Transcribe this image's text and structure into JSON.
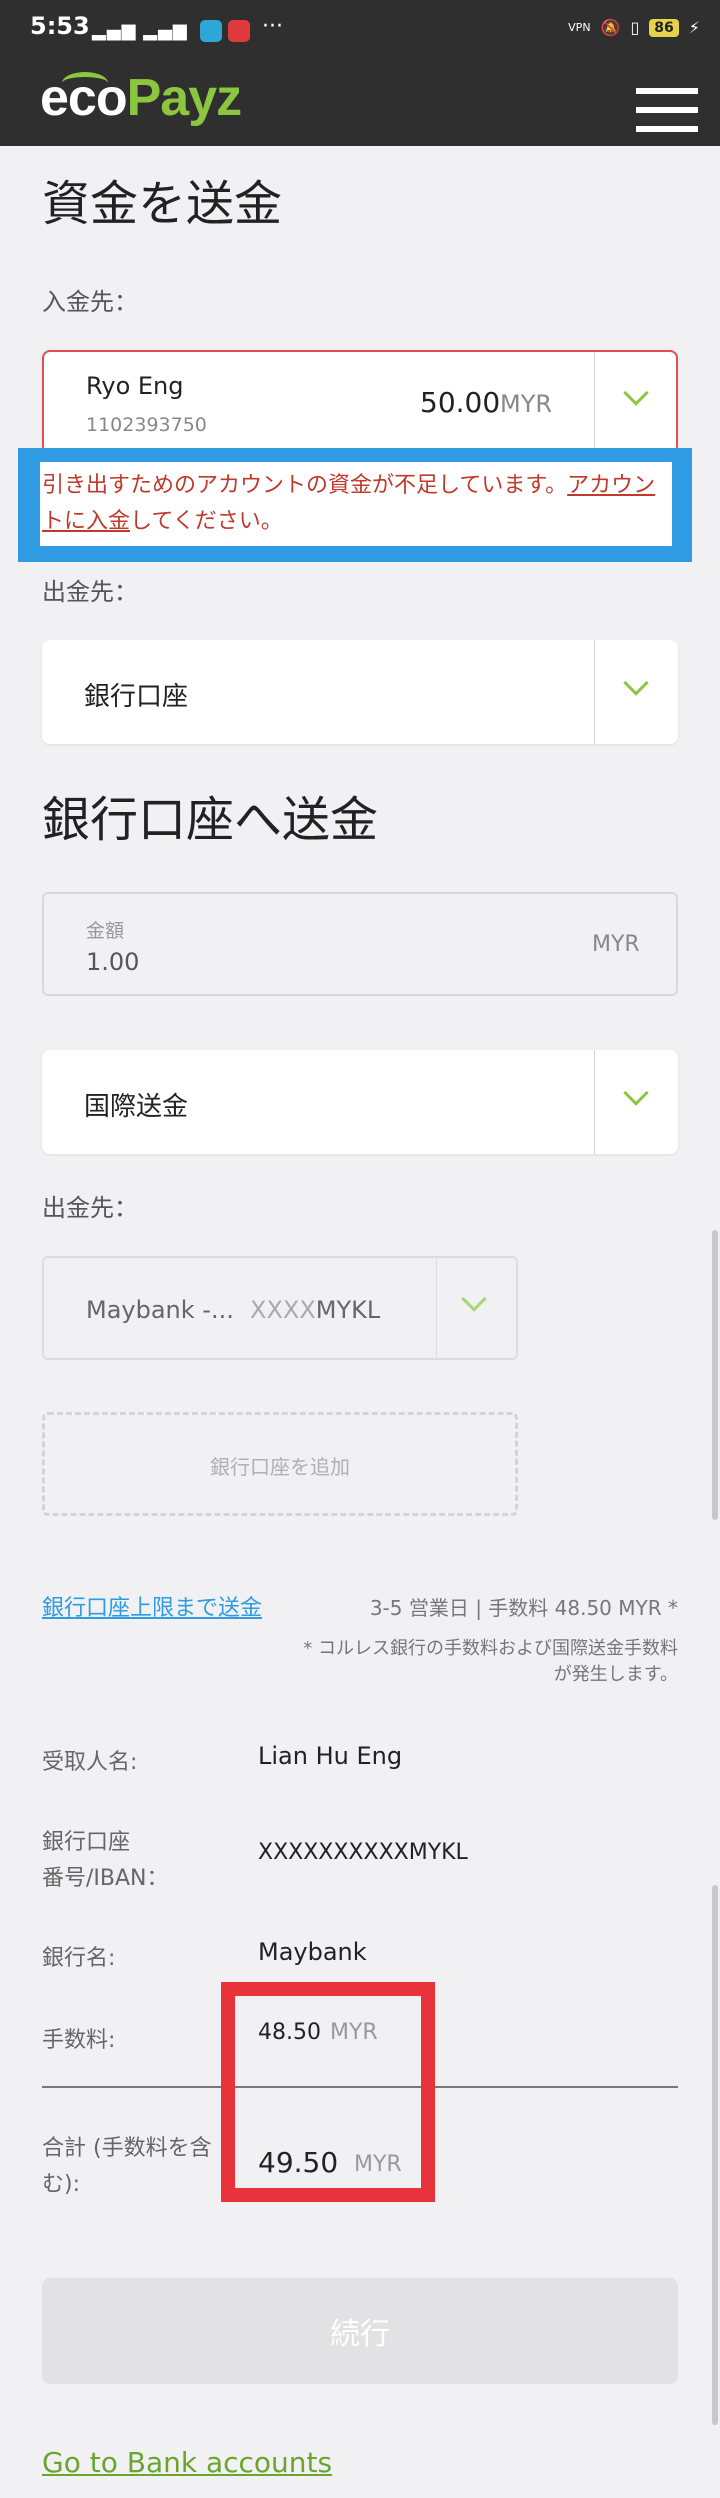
{
  "status_bar": {
    "time": "5:53",
    "signal": "▂▄▆ ▂▄▆",
    "overflow": "···",
    "vpn": "VPN",
    "battery": "86"
  },
  "header": {
    "logo_part1": "eco",
    "logo_part2": "Payz",
    "brand_color": "#8cc63f"
  },
  "transfer": {
    "title": "資金を送金",
    "to_label": "入金先：",
    "to_account": {
      "name": "Ryo Eng",
      "number": "1102393750",
      "balance": "50.00",
      "currency": "MYR"
    },
    "error_text_main": "引き出すためのアカウントの資金が不足しています。",
    "error_link": "アカウントに入金",
    "error_text_tail": "してください。",
    "from_label": "出金先：",
    "from_method": "銀行口座"
  },
  "bank_transfer": {
    "title": "銀行口座へ送金",
    "amount_label": "金額",
    "amount_value": "1.00",
    "amount_currency": "MYR",
    "transfer_type": "国際送金",
    "dest_label": "出金先：",
    "bank_name": "Maybank -...",
    "bank_mask": "XXXX",
    "bank_suffix": "MYKL",
    "add_bank": "銀行口座を追加",
    "max_link": "銀行口座上限まで送金",
    "fee_info": "3-5 営業日 | 手数料 48.50 MYR *",
    "fee_note_1": "* コルレス銀行の手数料および国際送金手数料",
    "fee_note_2": "が発生します。"
  },
  "summary": {
    "recipient_label": "受取人名:",
    "recipient_value": "Lian Hu Eng",
    "iban_label_1": "銀行口座",
    "iban_label_2": "番号/IBAN：",
    "iban_value": "XXXXXXXXXXMYKL",
    "bank_label": "銀行名:",
    "bank_value": "Maybank",
    "fee_label": "手数料:",
    "fee_value": "48.50",
    "fee_currency": "MYR",
    "total_label_1": "合計 (手数料を含",
    "total_label_2": "む):",
    "total_value": "49.50",
    "total_currency": "MYR"
  },
  "actions": {
    "continue": "続行",
    "go_bank": "Go to Bank accounts"
  }
}
